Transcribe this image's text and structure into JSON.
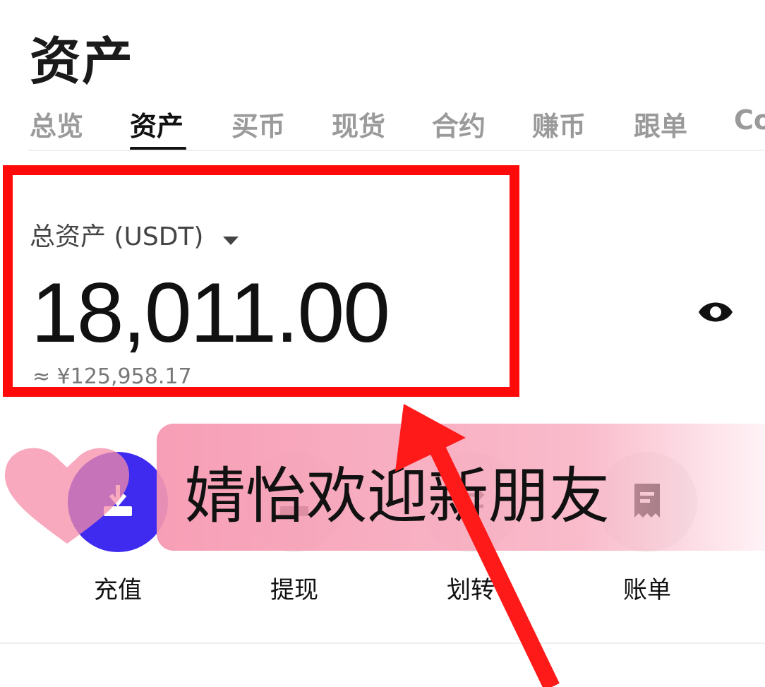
{
  "header": {
    "title": "资产"
  },
  "tabs": [
    {
      "label": "总览"
    },
    {
      "label": "资产"
    },
    {
      "label": "买币"
    },
    {
      "label": "现货"
    },
    {
      "label": "合约"
    },
    {
      "label": "赚币"
    },
    {
      "label": "跟单"
    },
    {
      "label": "Co"
    }
  ],
  "active_tab_index": 1,
  "balance": {
    "label": "总资产 (USDT)",
    "value": "18,011.00",
    "approx_cny": "≈ ¥125,958.17",
    "visibility_icon": "eye-icon"
  },
  "actions": [
    {
      "label": "充值",
      "icon": "deposit-icon"
    },
    {
      "label": "提现",
      "icon": "withdraw-icon"
    },
    {
      "label": "划转",
      "icon": "transfer-icon"
    },
    {
      "label": "账单",
      "icon": "bill-icon"
    }
  ],
  "overlay": {
    "banner_text": "婧怡欢迎新朋友",
    "highlight_color": "#ff0a0a",
    "banner_color": "#f696af"
  },
  "colors": {
    "primary_action": "#3f2bf0",
    "text": "#111111",
    "tab_inactive": "#9a9a9a"
  }
}
